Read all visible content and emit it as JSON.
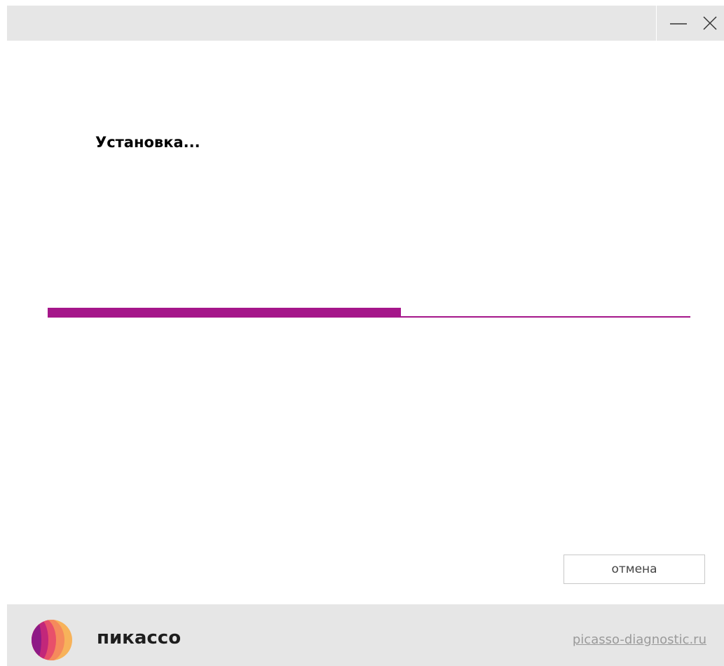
{
  "window": {
    "minimize_icon": "minimize-icon",
    "close_icon": "close-icon"
  },
  "main": {
    "heading": "Установка..."
  },
  "progress": {
    "fraction": 0.55,
    "color": "#a5168a"
  },
  "actions": {
    "cancel_label": "отмена"
  },
  "footer": {
    "brand": "пикассо",
    "logo_icon": "picasso-logo-icon",
    "site_link": "picasso-diagnostic.ru"
  },
  "colors": {
    "accent": "#a5168a",
    "titlebar_bg": "#e6e6e6",
    "footer_bg": "#e6e6e6",
    "link": "#9a9a9a"
  }
}
